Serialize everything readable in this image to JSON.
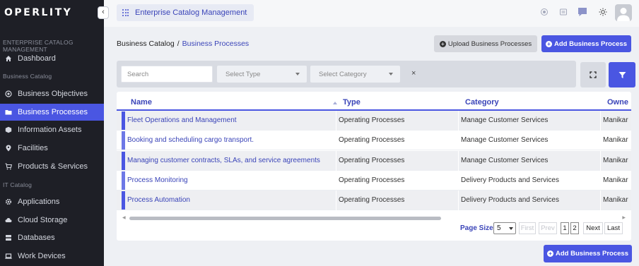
{
  "app": {
    "logo": "OPERLITY",
    "collapse_icon": "‹",
    "header_title": "Enterprise Catalog Management"
  },
  "sidebar": {
    "section_top": "ENTERPRISE CATALOG MANAGEMENT",
    "dashboard": "Dashboard",
    "section_business": "Business Catalog",
    "items_business": [
      "Business Objectives",
      "Business Processes",
      "Information Assets",
      "Facilities",
      "Products & Services"
    ],
    "section_it": "IT Catalog",
    "items_it": [
      "Applications",
      "Cloud Storage",
      "Databases",
      "Work Devices"
    ],
    "active": "Business Processes"
  },
  "breadcrumb": {
    "root": "Business Catalog",
    "separator": "/",
    "current": "Business Processes"
  },
  "actions": {
    "upload": "Upload Business Processes",
    "add": "Add Business Process",
    "add_bottom": "Add Business Process"
  },
  "filters": {
    "search_placeholder": "Search",
    "type_placeholder": "Select Type",
    "category_placeholder": "Select Category",
    "clear": "×"
  },
  "table": {
    "columns": [
      "Name",
      "Type",
      "Category",
      "Owne"
    ],
    "rows": [
      {
        "name": "Fleet Operations and Management",
        "type": "Operating Processes",
        "category": "Manage Customer Services",
        "owner": "Manikar"
      },
      {
        "name": "Booking and scheduling cargo transport.",
        "type": "Operating Processes",
        "category": "Manage Customer Services",
        "owner": "Manikar"
      },
      {
        "name": "Managing customer contracts, SLAs, and service agreements",
        "type": "Operating Processes",
        "category": "Manage Customer Services",
        "owner": "Manikar"
      },
      {
        "name": "Process Monitoring",
        "type": "Operating Processes",
        "category": "Delivery Products and Services",
        "owner": "Manikar"
      },
      {
        "name": "Process Automation",
        "type": "Operating Processes",
        "category": "Delivery Products and Services",
        "owner": "Manikar"
      }
    ]
  },
  "pagination": {
    "page_size_label": "Page Size",
    "page_size": "5",
    "first": "First",
    "prev": "Prev",
    "pages": [
      "1",
      "2"
    ],
    "next": "Next",
    "last": "Last"
  },
  "colors": {
    "accent": "#4a56e2",
    "sidebar_bg": "#1e1f26",
    "link": "#3a44b8"
  }
}
